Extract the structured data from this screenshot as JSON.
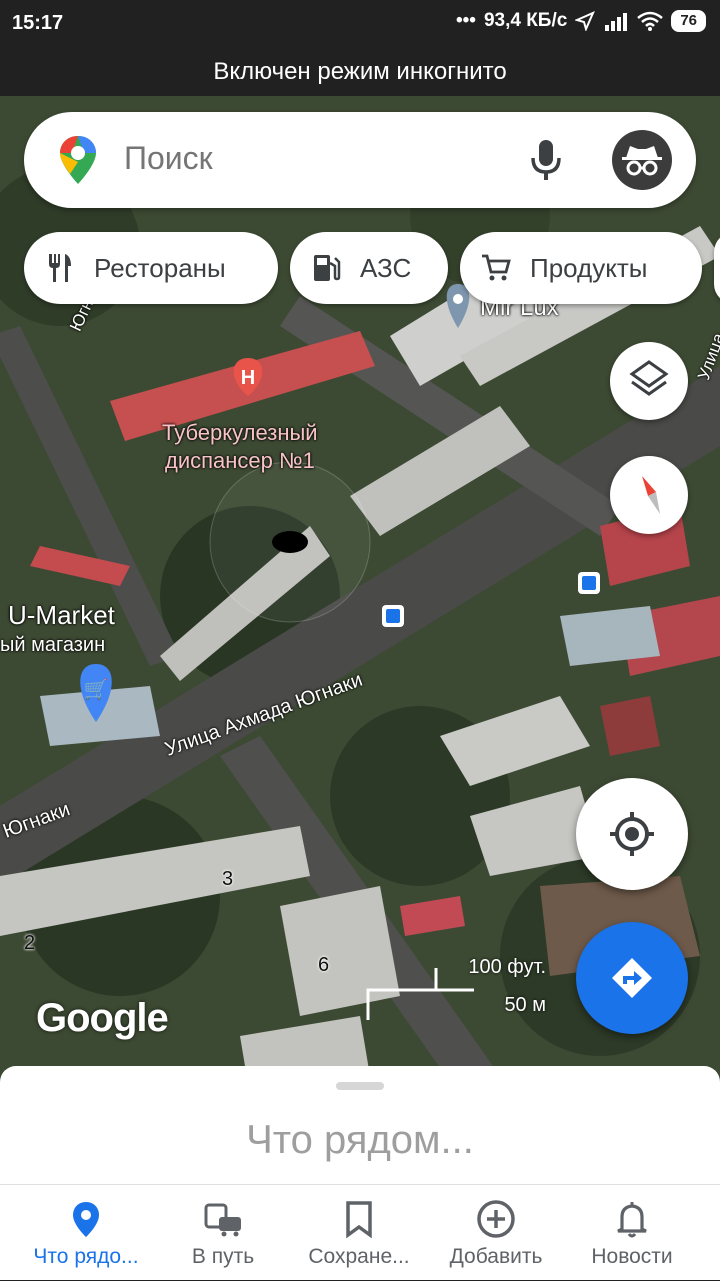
{
  "status_bar": {
    "time": "15:17",
    "net_speed": "93,4 КБ/с",
    "battery": "76"
  },
  "incognito_banner": "Включен режим инкогнито",
  "search": {
    "placeholder": "Поиск"
  },
  "chips": [
    {
      "label": "Рестораны",
      "icon": "fork-knife-icon"
    },
    {
      "label": "АЗС",
      "icon": "gas-station-icon"
    },
    {
      "label": "Продукты",
      "icon": "shopping-cart-icon"
    }
  ],
  "map_labels": {
    "mir_lux": "Mir Lux",
    "dispensary_line1": "Туберкулезный",
    "dispensary_line2": "диспансер №1",
    "umarket": "U-Market",
    "umarket_sub": "ый магазин",
    "street_main": "Улица Ахмада Югнаки",
    "street_left": "Югнаки",
    "street_top": "Югнак",
    "street_right": "Улица",
    "house_3": "3",
    "house_2": "2",
    "house_6": "6"
  },
  "scale": {
    "imperial": "100 фут.",
    "metric": "50 м"
  },
  "google_logo": "Google",
  "sheet": {
    "title": "Что рядом..."
  },
  "nav": [
    {
      "label": "Что рядо...",
      "icon": "location-pin-icon",
      "active": true
    },
    {
      "label": "В путь",
      "icon": "commute-icon",
      "active": false
    },
    {
      "label": "Сохране...",
      "icon": "bookmark-icon",
      "active": false
    },
    {
      "label": "Добавить",
      "icon": "add-circle-icon",
      "active": false
    },
    {
      "label": "Новости",
      "icon": "bell-icon",
      "active": false
    }
  ],
  "colors": {
    "accent_blue": "#1a73e8",
    "hospital_red": "#e8534a",
    "shop_blue": "#4285f4"
  }
}
